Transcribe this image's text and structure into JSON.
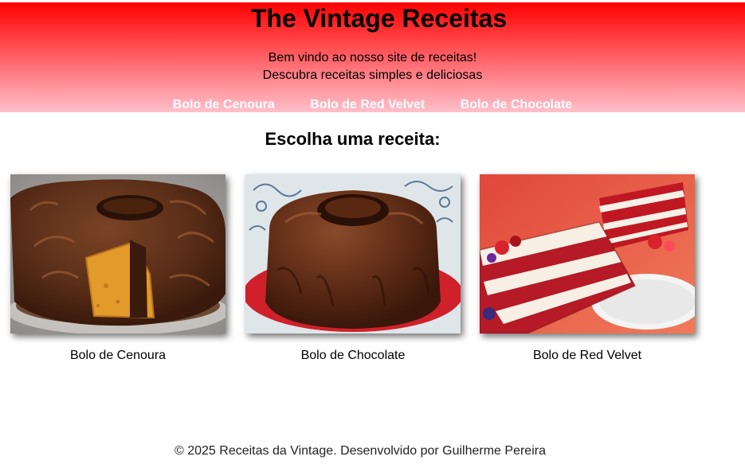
{
  "header": {
    "title": "The Vintage Receitas",
    "welcome_line1": "Bem vindo ao nosso site de receitas!",
    "welcome_line2": "Descubra receitas simples e deliciosas",
    "nav": [
      {
        "label": "Bolo de Cenoura"
      },
      {
        "label": "Bolo de Red Velvet"
      },
      {
        "label": "Bolo de Chocolate"
      }
    ],
    "gradient_top": "#ff0000",
    "gradient_bottom": "#ffc0cb"
  },
  "main": {
    "section_title": "Escolha uma receita:",
    "recipes": [
      {
        "name": "Bolo de Cenoura",
        "image": "carrot-cake-with-chocolate-photo"
      },
      {
        "name": "Bolo de Chocolate",
        "image": "chocolate-bundt-cake-photo"
      },
      {
        "name": "Bolo de Red Velvet",
        "image": "red-velvet-cake-slices-photo"
      }
    ]
  },
  "footer": {
    "text": "© 2025 Receitas da Vintage. Desenvolvido por Guilherme Pereira"
  }
}
